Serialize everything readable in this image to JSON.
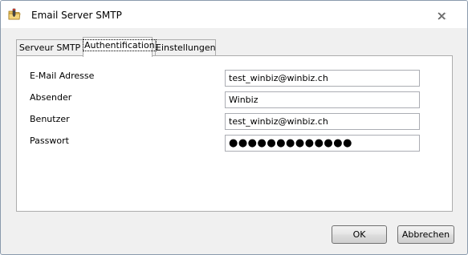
{
  "window": {
    "title": "Email Server SMTP",
    "app_icon": "folder-pencil-icon",
    "close_icon": "close-icon"
  },
  "tabs": [
    {
      "label": "Serveur SMTP",
      "active": false
    },
    {
      "label": "Authentification",
      "active": true
    },
    {
      "label": "Einstellungen",
      "active": false
    }
  ],
  "form": {
    "email_label": "E-Mail Adresse",
    "email_value": "test_winbiz@winbiz.ch",
    "sender_label": "Absender",
    "sender_value": "Winbiz",
    "user_label": "Benutzer",
    "user_value": "test_winbiz@winbiz.ch",
    "password_label": "Passwort",
    "password_masked": "●●●●●●●●●●●●●"
  },
  "buttons": {
    "ok": "OK",
    "cancel": "Abbrechen"
  }
}
